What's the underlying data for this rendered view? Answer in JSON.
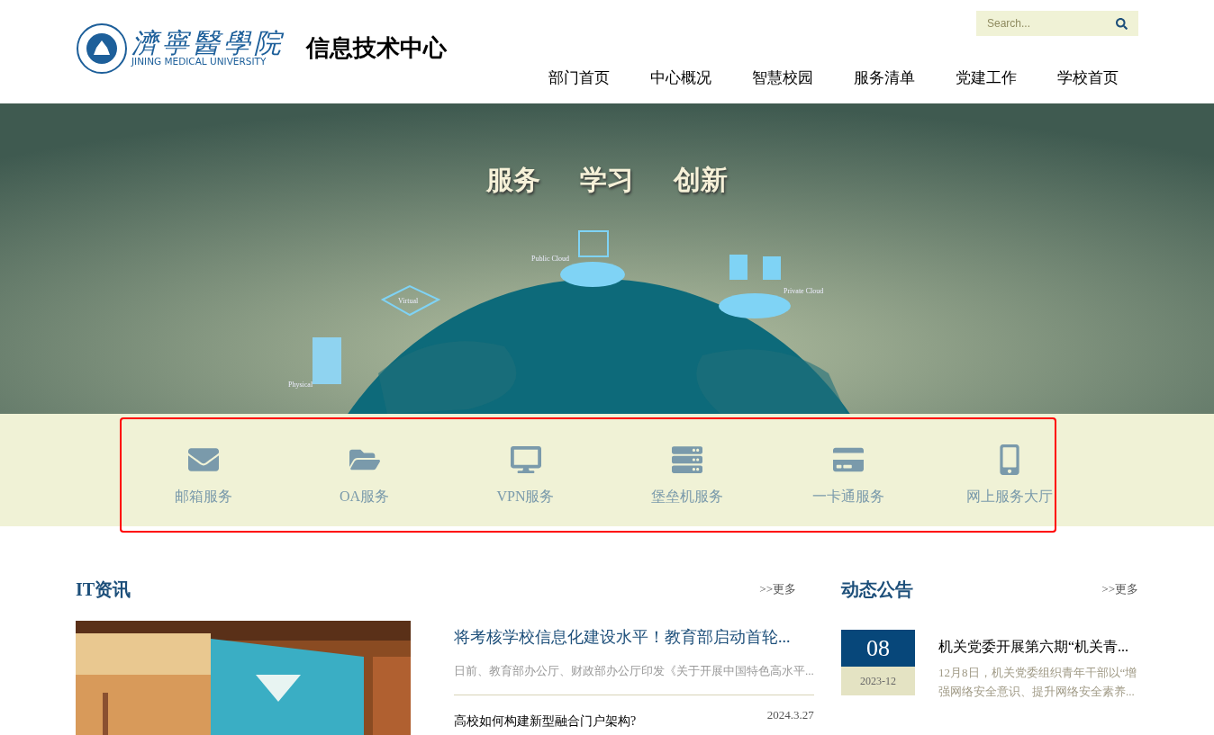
{
  "header": {
    "logo_text": "JINING MEDICAL UNIVERSITY",
    "logo_chinese": "濟寧醫學院",
    "site_title": "信息技术中心",
    "search": {
      "placeholder": "Search..."
    },
    "nav": [
      {
        "label": "部门首页"
      },
      {
        "label": "中心概况"
      },
      {
        "label": "智慧校园"
      },
      {
        "label": "服务清单"
      },
      {
        "label": "党建工作"
      },
      {
        "label": "学校首页"
      }
    ]
  },
  "banner": {
    "slogan": [
      "服务",
      "学习",
      "创新"
    ],
    "labels": [
      "Public Cloud",
      "Private Cloud",
      "Virtual",
      "Physical"
    ]
  },
  "services": {
    "highlighted": true,
    "items": [
      {
        "kind": "mail",
        "label": "邮箱服务"
      },
      {
        "kind": "folder",
        "label": "OA服务"
      },
      {
        "kind": "vpn",
        "label": "VPN服务"
      },
      {
        "kind": "server",
        "label": "堡垒机服务"
      },
      {
        "kind": "card",
        "label": "一卡通服务"
      },
      {
        "kind": "phone",
        "label": "网上服务大厅"
      }
    ]
  },
  "it_news": {
    "title": "IT资讯",
    "more": ">>更多",
    "featured": {
      "title": "将考核学校信息化建设水平！教育部启动首轮...",
      "summary": "日前、教育部办公厅、财政部办公厅印发《关于开展中国特色高水平..."
    },
    "items": [
      {
        "title": "高校如何构建新型融合门户架构?",
        "date": "2024.3.27"
      }
    ]
  },
  "notices": {
    "title": "动态公告",
    "more": ">>更多",
    "items": [
      {
        "day": "08",
        "month": "2023-12",
        "title": "机关党委开展第六期“机关青...",
        "summary": "12月8日，机关党委组织青年干部以“增强网络安全意识、提升网络安全素养..."
      }
    ]
  }
}
